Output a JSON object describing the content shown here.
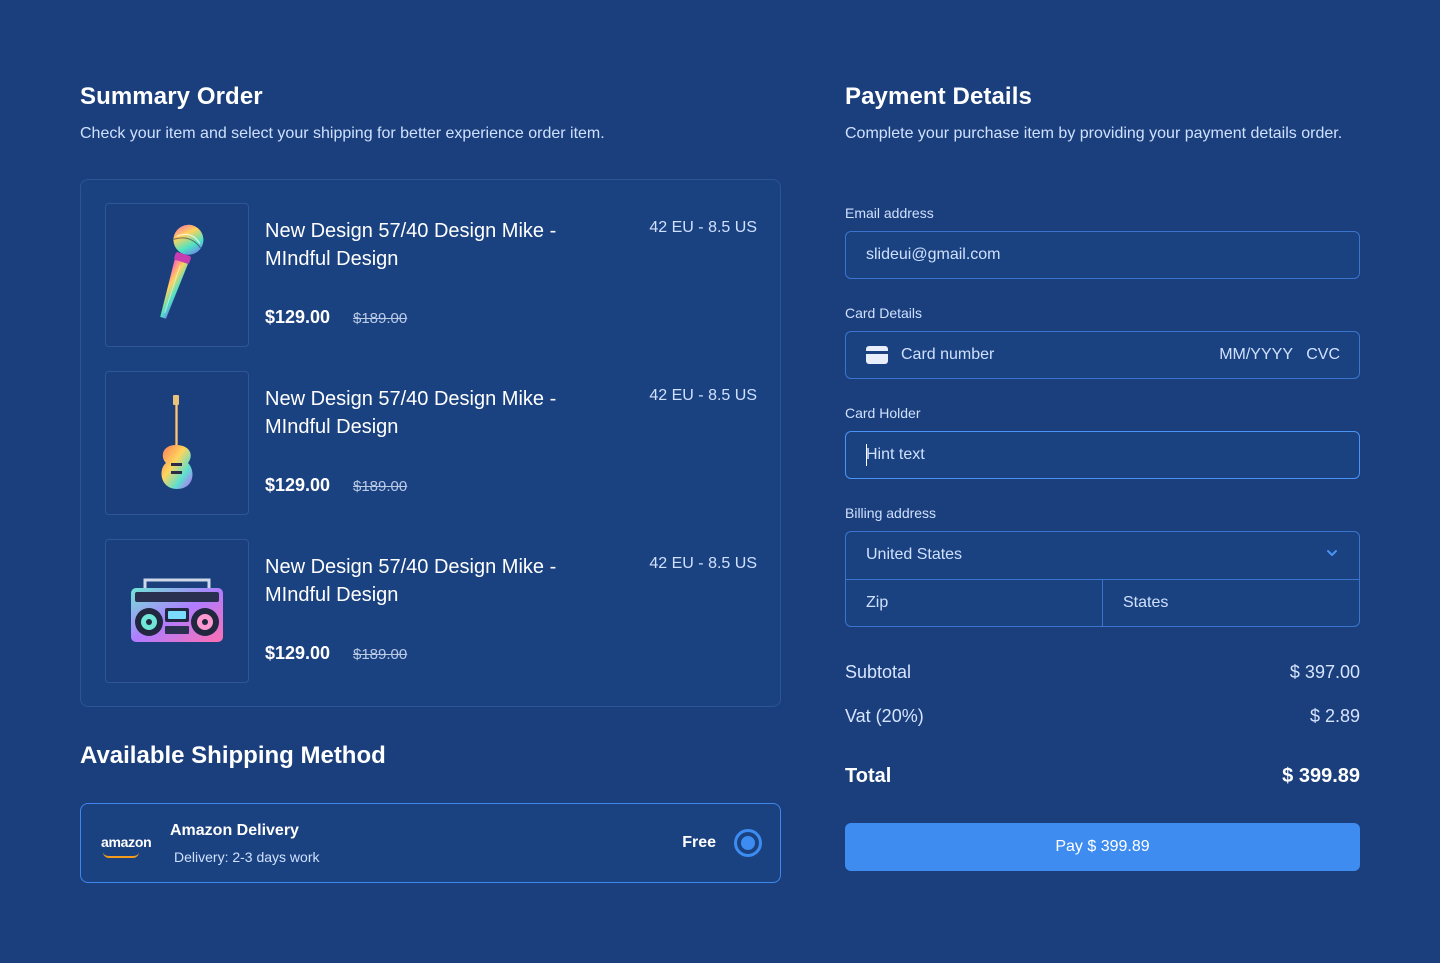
{
  "summary": {
    "title": "Summary Order",
    "subtitle": "Check your item and select your shipping for better experience order item."
  },
  "items": [
    {
      "name": "New Design 57/40 Design Mike - MIndful Design",
      "size": "42 EU - 8.5 US",
      "price": "$129.00",
      "old_price": "$189.00",
      "icon": "microphone-image"
    },
    {
      "name": "New Design 57/40 Design Mike - MIndful Design",
      "size": "42 EU - 8.5 US",
      "price": "$129.00",
      "old_price": "$189.00",
      "icon": "guitar-image"
    },
    {
      "name": "New Design 57/40 Design Mike - MIndful Design",
      "size": "42 EU - 8.5 US",
      "price": "$129.00",
      "old_price": "$189.00",
      "icon": "boombox-image"
    }
  ],
  "shipping": {
    "title": "Available Shipping Method",
    "provider_logo": "amazon",
    "name": "Amazon Delivery",
    "desc": "Delivery: 2-3 days work",
    "price": "Free",
    "selected": true
  },
  "payment": {
    "title": "Payment Details",
    "subtitle": "Complete your purchase item by providing your payment details order.",
    "email_label": "Email address",
    "email_value": "slideui@gmail.com",
    "card_label": "Card Details",
    "card_placeholder": "Card number",
    "card_expiry": "MM/YYYY",
    "card_cvc": "CVC",
    "holder_label": "Card Holder",
    "holder_placeholder": "Hint text",
    "billing_label": "Billing address",
    "billing_country": "United States",
    "billing_zip": "Zip",
    "billing_states": "States"
  },
  "totals": {
    "subtotal_label": "Subtotal",
    "subtotal_value": "$ 397.00",
    "vat_label": "Vat (20%)",
    "vat_value": "$ 2.89",
    "total_label": "Total",
    "total_value": "$ 399.89"
  },
  "pay_button": "Pay $ 399.89",
  "colors": {
    "background": "#1a3f7c",
    "accent": "#3e8cf0",
    "amazon_orange": "#f29b1d"
  }
}
